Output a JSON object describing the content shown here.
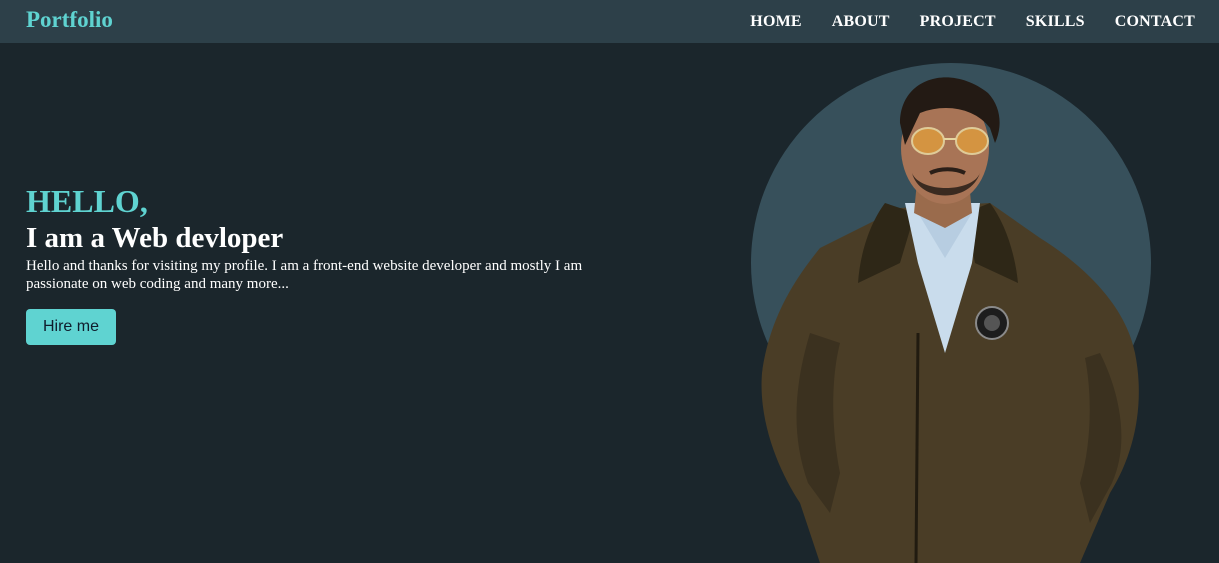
{
  "navbar": {
    "logo": "Portfolio",
    "links": [
      {
        "label": "HOME"
      },
      {
        "label": "ABOUT"
      },
      {
        "label": "PROJECT"
      },
      {
        "label": "SKILLS"
      },
      {
        "label": "CONTACT"
      }
    ]
  },
  "hero": {
    "greeting": "HELLO,",
    "headline": "I am a Web devloper",
    "intro": "Hello and thanks for visiting my profile. I am a front-end website developer and mostly I am passionate on web coding and many more...",
    "cta_label": "Hire me"
  },
  "colors": {
    "accent": "#5fd3d1",
    "navbar_bg": "#2d4049",
    "page_bg": "#1b262c",
    "circle": "#37505b"
  }
}
